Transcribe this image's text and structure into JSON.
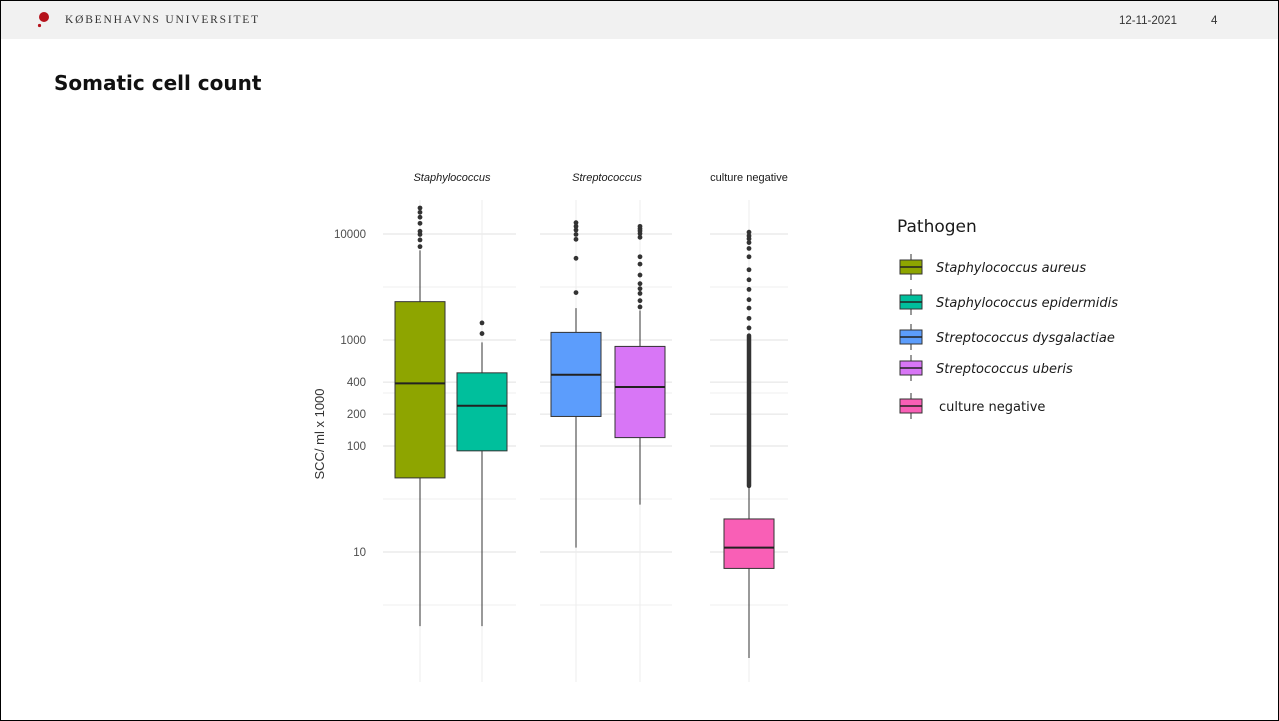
{
  "header": {
    "university": "KØBENHAVNS UNIVERSITET",
    "date": "12-11-2021",
    "page_number": "4"
  },
  "slide_title": "Somatic cell count",
  "colors": {
    "staph_aureus": "#8ea500",
    "staph_epidermidis": "#00bf9c",
    "strep_dysgalactiae": "#5c9dfc",
    "strep_uberis": "#d876f6",
    "culture_negative": "#f95fb6",
    "logo": "#b5121b"
  },
  "chart_data": {
    "type": "boxplot",
    "ylabel": "SCC/ ml x 1000",
    "yscale": "log10",
    "ylim": [
      0.5,
      26000
    ],
    "yticks": [
      10,
      100,
      200,
      400,
      1000,
      10000
    ],
    "yticklabels": [
      "10",
      "100",
      "200",
      "400",
      "1000",
      "10000"
    ],
    "facets": [
      {
        "label": "Staphylococcus",
        "italic": true,
        "boxes": [
          {
            "series": "Staphylococcus aureus",
            "whisker_low": 2,
            "q1": 50,
            "median": 390,
            "q3": 2300,
            "whisker_high": 7000,
            "outliers": [
              7600,
              8800,
              9900,
              10600,
              12600,
              14400,
              16000,
              17600
            ]
          },
          {
            "series": "Staphylococcus epidermidis",
            "whisker_low": 2,
            "q1": 90,
            "median": 240,
            "q3": 490,
            "whisker_high": 950,
            "outliers": [
              1150,
              1450
            ]
          }
        ]
      },
      {
        "label": "Streptococcus",
        "italic": true,
        "boxes": [
          {
            "series": "Streptococcus dysgalactiae",
            "whisker_low": 11,
            "q1": 190,
            "median": 470,
            "q3": 1180,
            "whisker_high": 2000,
            "outliers": [
              2800,
              5900,
              8900,
              9900,
              10900,
              11800,
              12800
            ]
          },
          {
            "series": "Streptococcus uberis",
            "whisker_low": 28,
            "q1": 120,
            "median": 360,
            "q3": 870,
            "whisker_high": 1900,
            "outliers": [
              2050,
              2350,
              2750,
              3050,
              3400,
              4100,
              5200,
              6100,
              9300,
              10100,
              10700,
              11200,
              11800
            ]
          }
        ]
      },
      {
        "label": "culture negative",
        "italic": false,
        "boxes": [
          {
            "series": "culture negative",
            "whisker_low": 1,
            "q1": 7,
            "median": 11,
            "q3": 20.5,
            "whisker_high": 42,
            "outliers_dense_from": 42,
            "outliers_dense_to": 1100,
            "outliers": [
              1300,
              1600,
              2000,
              2400,
              3000,
              3700,
              4600,
              6100,
              7300,
              8300,
              9000,
              9600,
              10400
            ]
          }
        ]
      }
    ],
    "legend": {
      "title": "Pathogen",
      "position": "right",
      "items": [
        {
          "label": "Staphylococcus aureus",
          "italic": true,
          "color_key": "staph_aureus"
        },
        {
          "label": "Staphylococcus epidermidis",
          "italic": true,
          "color_key": "staph_epidermidis"
        },
        {
          "label": "Streptococcus dysgalactiae",
          "italic": true,
          "color_key": "strep_dysgalactiae"
        },
        {
          "label": "Streptococcus uberis",
          "italic": true,
          "color_key": "strep_uberis"
        },
        {
          "label": "culture negative",
          "italic": false,
          "color_key": "culture_negative"
        }
      ]
    }
  }
}
